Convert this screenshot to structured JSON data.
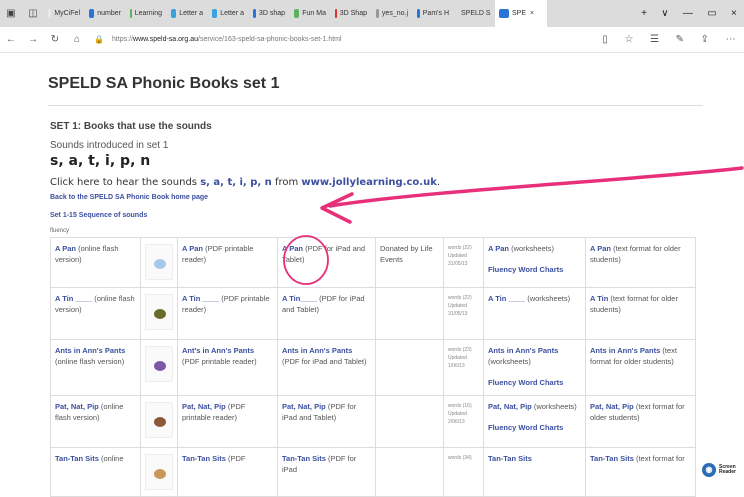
{
  "browser": {
    "tabs": [
      {
        "label": "MyCiFel",
        "color": "#e8e8e8"
      },
      {
        "label": "number",
        "color": "#2b74d8"
      },
      {
        "label": "Learning",
        "color": "#5bb45b"
      },
      {
        "label": "Letter a",
        "color": "#3aa0e0"
      },
      {
        "label": "Letter a",
        "color": "#3aa0e0"
      },
      {
        "label": "3D shap",
        "color": "#2b74d8"
      },
      {
        "label": "Fun Ma",
        "color": "#5bb45b"
      },
      {
        "label": "3D Shap",
        "color": "#e03030"
      },
      {
        "label": "yes_no.j",
        "color": "#999999"
      },
      {
        "label": "Pam's H",
        "color": "#2b74d8"
      },
      {
        "label": "SPELD S",
        "color": "#2b74d8"
      },
      {
        "label": "SPE",
        "color": "#2b74d8"
      }
    ],
    "url_prefix": "https://",
    "url_domain": "www.speld-sa.org.au",
    "url_path": "/service/163-speld-sa-phonic-books-set-1.html",
    "controls": {
      "close": "×",
      "new": "+",
      "menu": "∨",
      "min": "—",
      "max": "▭",
      "winclose": "×"
    }
  },
  "page": {
    "title": "SPELD SA Phonic Books set 1",
    "set_heading": "SET 1: Books that use the sounds",
    "intro": "Sounds introduced in set 1",
    "sounds": "s, a, t, i, p, n",
    "click_prefix": "Click here to hear the sounds ",
    "click_sounds": "s, a, t, i, p, n",
    "click_from": " from ",
    "click_site": "www.jollylearning.co.uk",
    "click_end": ".",
    "back_link": "Back to the SPELD SA Phonic Book home page",
    "seq_prefix": "Set 1-15 ",
    "seq_link": "Sequence of sounds",
    "fluency": "fluency"
  },
  "table": {
    "rows": [
      {
        "c1t": "A Pan",
        "c1": " (online flash version)",
        "thumb": "#a8c8e8",
        "c3t": "A Pan",
        "c3": " (PDF printable reader)",
        "c4t": "A Pan",
        "c4": " (PDF for iPad and Tablet)",
        "c5": "Donated by Life Events",
        "c6a": "words (22)",
        "c6b": "Updated",
        "c6c": "31/05/13",
        "c7t": "A Pan",
        "c7": " (worksheets)",
        "c7f": "Fluency Word Charts",
        "c8t": "A Pan",
        "c8": " (text format for older students)"
      },
      {
        "c1t": "A Tin ____",
        "c1": " (online flash version)",
        "thumb": "#6b6b2a",
        "c3t": "A Tin ____",
        "c3": " (PDF printable reader)",
        "c4t": "A Tin____",
        "c4": " (PDF for iPad and Tablet)",
        "c5": "",
        "c6a": "words (22)",
        "c6b": "Updated",
        "c6c": "31/05/13",
        "c7t": "A Tin ____",
        "c7": " (worksheets)",
        "c7f": "",
        "c8t": "A Tin",
        "c8": " (text format for older students)"
      },
      {
        "c1t": "Ants in Ann's Pants",
        "c1": " (online flash version)",
        "thumb": "#7a5aa8",
        "c3t": "Ant's in Ann's Pants",
        "c3": " (PDF printable reader)",
        "c4t": "Ants in Ann's Pants",
        "c4": " (PDF for iPad and Tablet)",
        "c5": "",
        "c6a": "words (23)",
        "c6b": "Updated",
        "c6c": "1/06/13",
        "c7t": "Ants in Ann's Pants",
        "c7": " (worksheets)",
        "c7f": "Fluency Word Charts",
        "c8t": "Ants in Ann's Pants",
        "c8": " (text format for older students)"
      },
      {
        "c1t": "Pat, Nat, Pip",
        "c1": " (online flash version)",
        "thumb": "#8a5a3a",
        "c3t": "Pat, Nat, Pip",
        "c3": " (PDF printable reader)",
        "c4t": "Pat, Nat, Pip",
        "c4": " (PDF for iPad and Tablet)",
        "c5": "",
        "c6a": "words (16)",
        "c6b": "Updated",
        "c6c": "2/06/13",
        "c7t": "Pat, Nat, Pip",
        "c7": " (worksheets)",
        "c7f": "Fluency Word Charts",
        "c8t": "Pat, Nat, Pip",
        "c8": " (text format for older students)"
      },
      {
        "c1t": "Tan-Tan Sits",
        "c1": " (online",
        "thumb": "#c89858",
        "c3t": "Tan-Tan Sits",
        "c3": " (PDF",
        "c4t": "Tan-Tan Sits",
        "c4": " (PDF for iPad",
        "c5": "",
        "c6a": "words (34)",
        "c6b": "",
        "c6c": "",
        "c7t": "Tan-Tan Sits",
        "c7": "",
        "c7f": "",
        "c8t": "Tan-Tan Sits",
        "c8": " (text format for"
      }
    ]
  },
  "screen_reader": {
    "line1": "Screen",
    "line2": "Reader"
  },
  "annotation": {
    "color": "#e8307a"
  }
}
